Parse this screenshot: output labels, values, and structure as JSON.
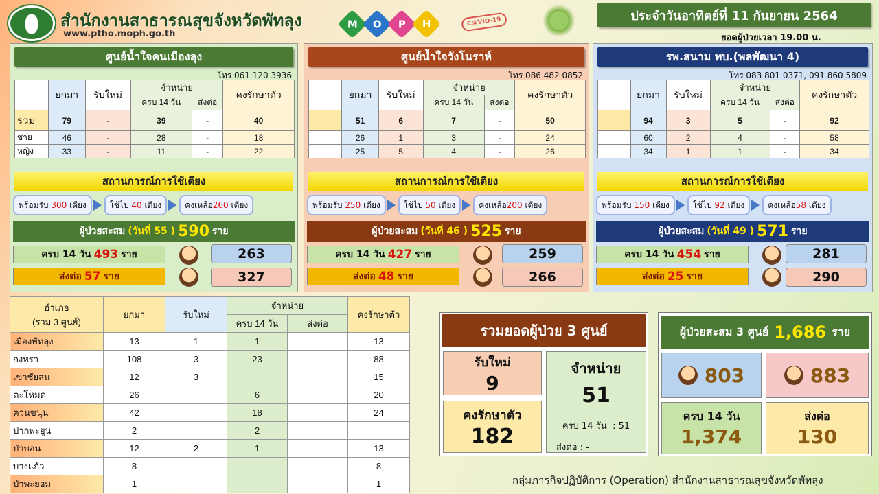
{
  "header": {
    "title": "สำนักงานสาธารณสุขจังหวัดพัทลุง",
    "website": "www.ptho.moph.go.th",
    "moph_letters": [
      "M",
      "O",
      "P",
      "H"
    ],
    "moph_colors": [
      "#2e9b45",
      "#2b76c9",
      "#e0458f",
      "#f2c200"
    ],
    "covid_badge": "C@VID-19",
    "date": "ประจำวันอาทิตย์ที่ 11 กันยายน 2564",
    "time_note": "ยอดผู้ป่วยเวลา 19.00 น."
  },
  "labels": {
    "carried": "ยกมา",
    "new": "รับใหม่",
    "discharge": "จำหน่าย",
    "complete14": "ครบ 14 วัน",
    "refer": "ส่งต่อ",
    "remaining": "คงรักษาตัว",
    "total": "รวม",
    "male": "ชาย",
    "female": "หญิง",
    "bed_status": "สถานการณ์การใช้เตียง",
    "ready": "พร้อมรับ",
    "used": "ใช้ไป",
    "left": "คงเหลือ",
    "bed_unit": "เตียง",
    "cum_prefix": "ผู้ป่วยสะสม",
    "day_prefix": "(วันที่",
    "day_suffix": ")",
    "person": "ราย"
  },
  "panels": [
    {
      "name": "ศูนย์น้ำใจคนเมืองลุง",
      "phone": "โทร 061 120 3936",
      "total": [
        "79",
        "-",
        "39",
        "-",
        "40"
      ],
      "male": [
        "46",
        "-",
        "28",
        "-",
        "18"
      ],
      "female": [
        "33",
        "-",
        "11",
        "-",
        "22"
      ],
      "bed_ready": "300",
      "bed_used": "40",
      "bed_left": "260",
      "cum_day": "55",
      "cum_total": "590",
      "done14": "493",
      "refer": "57",
      "boys": "263",
      "girls": "327",
      "head_color": "#4a7a33",
      "bg": "#d8edc8",
      "cum_color": "#4a7a33"
    },
    {
      "name": "ศูนย์น้ำใจวังโนราห์",
      "phone": "โทร 086 482 0852",
      "total": [
        "51",
        "6",
        "7",
        "-",
        "50"
      ],
      "male": [
        "26",
        "1",
        "3",
        "-",
        "24"
      ],
      "female": [
        "25",
        "5",
        "4",
        "-",
        "26"
      ],
      "bed_ready": "250",
      "bed_used": "50",
      "bed_left": "200",
      "cum_day": "46",
      "cum_total": "525",
      "done14": "427",
      "refer": "48",
      "boys": "259",
      "girls": "266",
      "head_color": "#a8471c",
      "bg": "#f7cdb4",
      "cum_color": "#8a3a12"
    },
    {
      "name": "รพ.สนาม ทบ.(พลพัฒนา 4)",
      "phone": "โทร 083 801 0371, 091 860 5809",
      "total": [
        "94",
        "3",
        "5",
        "-",
        "92"
      ],
      "male": [
        "60",
        "2",
        "4",
        "-",
        "58"
      ],
      "female": [
        "34",
        "1",
        "1",
        "-",
        "34"
      ],
      "bed_ready": "150",
      "bed_used": "92",
      "bed_left": "58",
      "cum_day": "49",
      "cum_total": "571",
      "done14": "454",
      "refer": "25",
      "boys": "281",
      "girls": "290",
      "head_color": "#1f3a7a",
      "bg": "#d2e2f4",
      "cum_color": "#1f3a7a"
    }
  ],
  "district_table": {
    "header_district": "อำเภอ",
    "header_sub": "(รวม 3 ศูนย์)",
    "rows": [
      [
        "เมืองพัทลุง",
        "13",
        "1",
        "1",
        "",
        "13"
      ],
      [
        "กงหรา",
        "108",
        "3",
        "23",
        "",
        "88"
      ],
      [
        "เขาชัยสน",
        "12",
        "3",
        "",
        "",
        "15"
      ],
      [
        "ตะโหมด",
        "26",
        "",
        "6",
        "",
        "20"
      ],
      [
        "ควนขนุน",
        "42",
        "",
        "18",
        "",
        "24"
      ],
      [
        "ปากพะยูน",
        "2",
        "",
        "2",
        "",
        ""
      ],
      [
        "ป่าบอน",
        "12",
        "2",
        "1",
        "",
        "13"
      ],
      [
        "บางแก้ว",
        "8",
        "",
        "",
        "",
        "8"
      ],
      [
        "ป่าพะยอม",
        "1",
        "",
        "",
        "",
        "1"
      ]
    ]
  },
  "summary": {
    "title": "รวมยอดผู้ป่วย 3 ศูนย์",
    "new_label": "รับใหม่",
    "new_value": "9",
    "discharge_label": "จำหน่าย",
    "discharge_value": "51",
    "remaining_label": "คงรักษาตัว",
    "remaining_value": "182",
    "detail_complete": "ครบ 14 วัน  : 51",
    "detail_refer": "ส่งต่อ : -"
  },
  "cumulative": {
    "label": "ผู้ป่วยสะสม 3 ศูนย์",
    "value": "1,686",
    "unit": "ราย",
    "boys": "803",
    "girls": "883",
    "done14_label": "ครบ 14 วัน",
    "done14_value": "1,374",
    "refer_label": "ส่งต่อ",
    "refer_value": "130"
  },
  "footer": "กลุ่มภารกิจปฏิบัติการ (Operation) สำนักงานสาธารณสุขจังหวัดพัทลุง"
}
